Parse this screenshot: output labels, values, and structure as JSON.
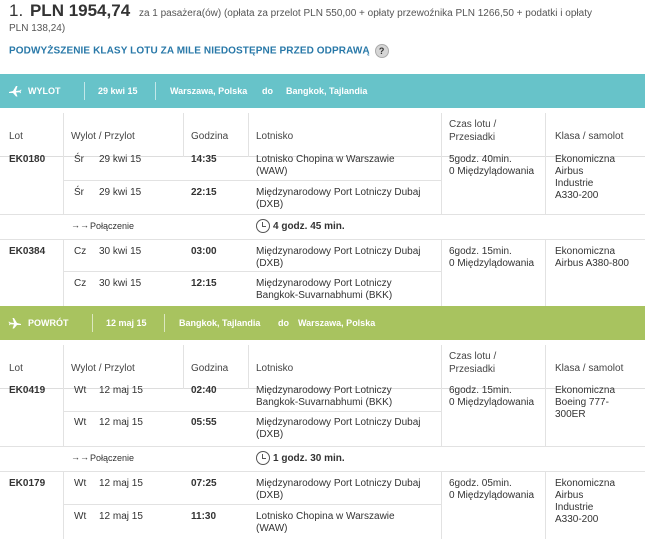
{
  "header": {
    "index": "1.",
    "price": "PLN 1954,74",
    "desc_line1": "za 1 pasażera(ów) (opłata za przelot PLN 550,00 + opłaty przewoźnika PLN 1266,50 + podatki i opłaty",
    "desc_line2": "PLN 138,24)",
    "upgrade": "PODWYŻSZENIE KLASY LOTU ZA MILE NIEDOSTĘPNE PRZED ODPRAWĄ",
    "help": "?"
  },
  "columns": {
    "lot": "Lot",
    "wylot": "Wylot / Przylot",
    "godzina": "Godzina",
    "lotnisko": "Lotnisko",
    "czas1": "Czas lotu /",
    "czas2": "Przesiadki",
    "klasa": "Klasa / samolot"
  },
  "outbound": {
    "dir": "WYLOT",
    "date": "29 kwi 15",
    "from": "Warszawa, Polska",
    "do": "do",
    "to": "Bangkok, Tajlandia",
    "flights": [
      {
        "code": "EK0180",
        "legs": [
          {
            "day": "Śr",
            "date": "29 kwi 15",
            "time": "14:35",
            "airport1": "Lotnisko Chopina w Warszawie",
            "airport2": "(WAW)"
          },
          {
            "day": "Śr",
            "date": "29 kwi 15",
            "time": "22:15",
            "airport1": "Międzynarodowy Port Lotniczy Dubaj",
            "airport2": "(DXB)"
          }
        ],
        "duration": "5godz. 40min.",
        "stops": "0 Międzylądowania",
        "cls": [
          "Ekonomiczna",
          "Airbus",
          "Industrie",
          "A330-200"
        ]
      },
      {
        "code": "EK0384",
        "legs": [
          {
            "day": "Cz",
            "date": "30 kwi 15",
            "time": "03:00",
            "airport1": "Międzynarodowy Port Lotniczy Dubaj",
            "airport2": "(DXB)"
          },
          {
            "day": "Cz",
            "date": "30 kwi 15",
            "time": "12:15",
            "airport1": "Międzynarodowy Port Lotniczy",
            "airport2": "Bangkok-Suvarnabhumi (BKK)"
          }
        ],
        "duration": "6godz. 15min.",
        "stops": "0 Międzylądowania",
        "cls": [
          "Ekonomiczna",
          "Airbus A380-800"
        ]
      }
    ],
    "connection": {
      "label": "Połączenie",
      "duration": "4 godz. 45 min."
    }
  },
  "return": {
    "dir": "POWRÓT",
    "date": "12 maj 15",
    "from": "Bangkok, Tajlandia",
    "do": "do",
    "to": "Warszawa, Polska",
    "flights": [
      {
        "code": "EK0419",
        "legs": [
          {
            "day": "Wt",
            "date": "12 maj 15",
            "time": "02:40",
            "airport1": "Międzynarodowy Port Lotniczy",
            "airport2": "Bangkok-Suvarnabhumi (BKK)"
          },
          {
            "day": "Wt",
            "date": "12 maj 15",
            "time": "05:55",
            "airport1": "Międzynarodowy Port Lotniczy Dubaj",
            "airport2": "(DXB)"
          }
        ],
        "duration": "6godz. 15min.",
        "stops": "0 Międzylądowania",
        "cls": [
          "Ekonomiczna",
          "Boeing 777-",
          "300ER"
        ]
      },
      {
        "code": "EK0179",
        "legs": [
          {
            "day": "Wt",
            "date": "12 maj 15",
            "time": "07:25",
            "airport1": "Międzynarodowy Port Lotniczy Dubaj",
            "airport2": "(DXB)"
          },
          {
            "day": "Wt",
            "date": "12 maj 15",
            "time": "11:30",
            "airport1": "Lotnisko Chopina w Warszawie",
            "airport2": "(WAW)"
          }
        ],
        "duration": "6godz. 05min.",
        "stops": "0 Międzylądowania",
        "cls": [
          "Ekonomiczna",
          "Airbus",
          "Industrie",
          "A330-200"
        ]
      }
    ],
    "connection": {
      "label": "Połączenie",
      "duration": "1 godz. 30 min."
    }
  },
  "colors": {
    "outbound_bar": "#67c3c9",
    "return_bar": "#a8c35f",
    "link": "#2878a8"
  }
}
